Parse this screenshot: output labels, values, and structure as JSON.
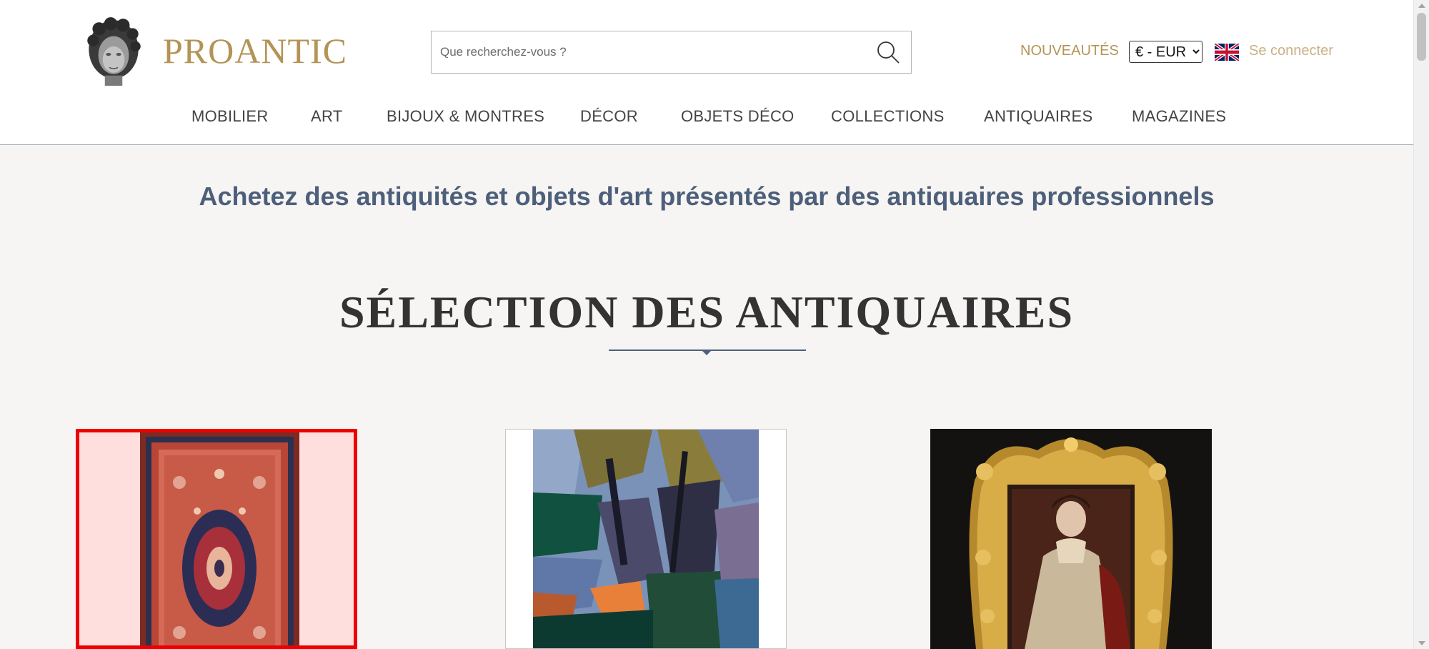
{
  "header": {
    "logo_text": "PROANTIC",
    "search": {
      "placeholder": "Que recherchez-vous ?",
      "value": ""
    },
    "nouveautes_label": "NOUVEAUTÉS",
    "currency": {
      "selected": "€ - EUR",
      "options": [
        "€ - EUR"
      ]
    },
    "language_flag": "uk-flag-icon",
    "login_label": "Se connecter"
  },
  "nav": {
    "items": [
      {
        "label": "MOBILIER"
      },
      {
        "label": "ART"
      },
      {
        "label": "BIJOUX & MONTRES"
      },
      {
        "label": "DÉCOR"
      },
      {
        "label": "OBJETS DÉCO"
      },
      {
        "label": "COLLECTIONS"
      },
      {
        "label": "ANTIQUAIRES"
      },
      {
        "label": "MAGAZINES"
      }
    ]
  },
  "main": {
    "tagline": "Achetez des antiquités et objets d'art présentés par des antiquaires professionnels",
    "section_title": "SÉLECTION DES ANTIQUAIRES"
  },
  "cards": [
    {
      "image": "persian-rug-image",
      "highlighted": true,
      "highlight_color": "#ee0000"
    },
    {
      "image": "abstract-painting-image",
      "highlighted": false
    },
    {
      "image": "framed-portrait-image",
      "highlighted": false
    }
  ],
  "colors": {
    "brand_gold": "#b39456",
    "login_gold": "#c9b184",
    "tagline_blue": "#4d5f7a",
    "page_background": "#f6f5f3",
    "highlight_red": "#ee0000"
  }
}
